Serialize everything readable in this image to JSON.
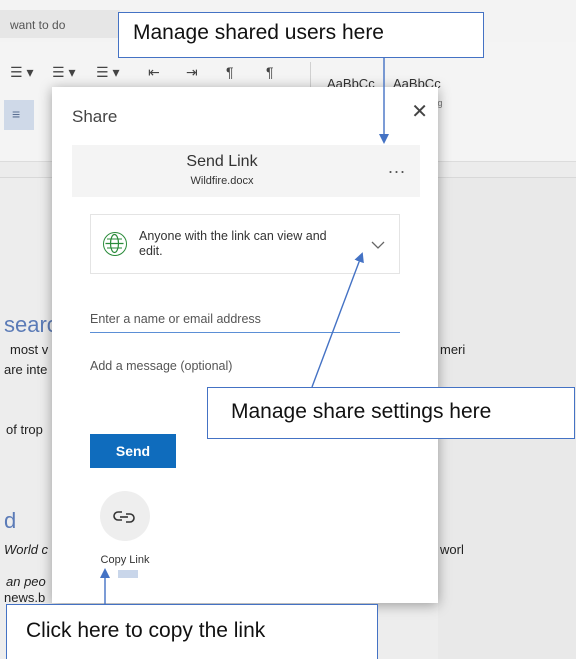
{
  "background": {
    "tell_me": "want to do",
    "styles": [
      {
        "label": "AaBbCc",
        "sub": ""
      },
      {
        "label": "AaBbCc",
        "sub": "acing"
      }
    ],
    "doc_fragments": [
      {
        "text": "searc",
        "kind": "heading"
      },
      {
        "text": "most v",
        "kind": "text"
      },
      {
        "text": "are inte",
        "kind": "text"
      },
      {
        "text": "of trop",
        "kind": "text"
      },
      {
        "text": "d",
        "kind": "heading"
      },
      {
        "text": "World c",
        "kind": "italic"
      },
      {
        "text": "an peo",
        "kind": "italic"
      },
      {
        "text": "news.b",
        "kind": "text"
      },
      {
        "text": "meri",
        "kind": "text"
      },
      {
        "text": "worl",
        "kind": "text"
      }
    ]
  },
  "dialog": {
    "title": "Share",
    "close_icon": "close-icon",
    "send_link": {
      "title": "Send Link",
      "file_name": "Wildfire.docx",
      "more_label": "..."
    },
    "permission": {
      "icon": "globe-icon",
      "text": "Anyone with the link can view and edit.",
      "dropdown_icon": "chevron-down-icon"
    },
    "email_placeholder": "Enter a name or email address",
    "message_placeholder": "Add a message (optional)",
    "send_label": "Send",
    "copy_link": {
      "icon": "link-icon",
      "label": "Copy Link"
    }
  },
  "callouts": {
    "users": "Manage shared users here",
    "settings": "Manage share settings here",
    "copy": "Click here to copy the link"
  },
  "colors": {
    "accent_blue": "#0f6cbd",
    "callout_border": "#4472c4",
    "globe_green": "#2a8b3a"
  }
}
